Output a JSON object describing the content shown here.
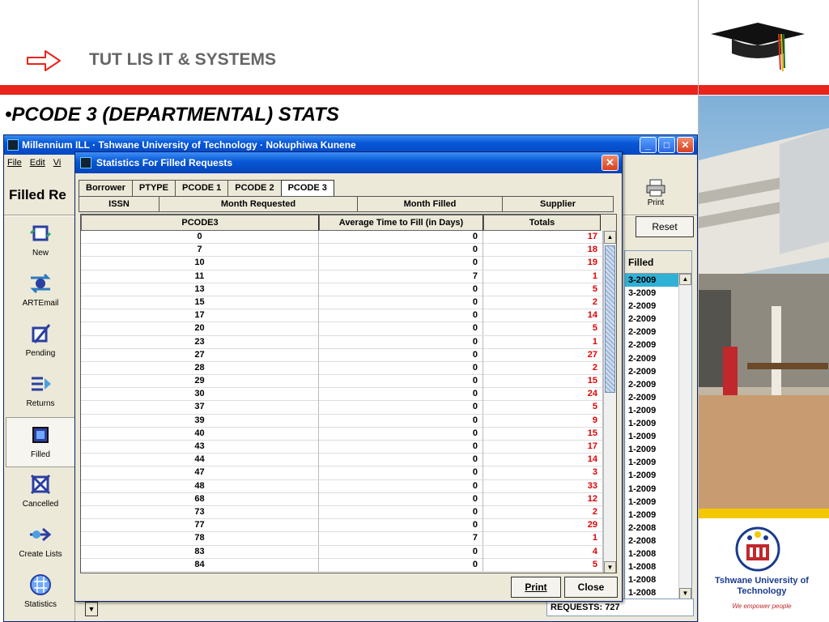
{
  "slide": {
    "title": "TUT LIS IT & SYSTEMS",
    "bullet": "•PCODE 3 (DEPARTMENTAL) STATS",
    "logo_name": "Tshwane University of Technology",
    "logo_motto": "We empower people",
    "colors": {
      "red_bar": "#e8241c",
      "gold_bar": "#f3c800",
      "accent_blue": "#1b3b8c"
    }
  },
  "app": {
    "title": "Millennium ILL · Tshwane University of Technology · Nokuphiwa Kunene",
    "menu": [
      "File",
      "Edit",
      "Vi"
    ],
    "heading": "Filled Re",
    "print_label": "Print",
    "reset_label": "Reset",
    "sidebar": [
      {
        "label": "New",
        "icon": "new-request-icon"
      },
      {
        "label": "ARTEmail",
        "icon": "artemail-icon"
      },
      {
        "label": "Pending",
        "icon": "pending-icon"
      },
      {
        "label": "Returns",
        "icon": "returns-icon"
      },
      {
        "label": "Filled",
        "icon": "filled-icon",
        "active": true
      },
      {
        "label": "Cancelled",
        "icon": "cancelled-icon"
      },
      {
        "label": "Create Lists",
        "icon": "create-lists-icon"
      },
      {
        "label": "Statistics",
        "icon": "statistics-icon"
      }
    ],
    "list_header": "Filled",
    "list_rows": [
      "3-2009",
      "3-2009",
      "2-2009",
      "2-2009",
      "2-2009",
      "2-2009",
      "2-2009",
      "2-2009",
      "2-2009",
      "2-2009",
      "1-2009",
      "1-2009",
      "1-2009",
      "1-2009",
      "1-2009",
      "1-2009",
      "1-2009",
      "1-2009",
      "1-2009",
      "2-2008",
      "2-2008",
      "1-2008",
      "1-2008",
      "1-2008",
      "1-2008"
    ],
    "status": "REQUESTS: 727"
  },
  "dialog": {
    "title": "Statistics For Filled Requests",
    "tabs_row1": [
      "Borrower",
      "PTYPE",
      "PCODE 1",
      "PCODE 2",
      "PCODE 3"
    ],
    "active_tab": "PCODE 3",
    "tabs_row2": [
      "ISSN",
      "Month Requested",
      "Month Filled",
      "Supplier"
    ],
    "columns": [
      "PCODE3",
      "Average Time to Fill (in Days)",
      "Totals"
    ],
    "rows": [
      [
        "0",
        "0",
        "17"
      ],
      [
        "7",
        "0",
        "18"
      ],
      [
        "10",
        "0",
        "19"
      ],
      [
        "11",
        "7",
        "1"
      ],
      [
        "13",
        "0",
        "5"
      ],
      [
        "15",
        "0",
        "2"
      ],
      [
        "17",
        "0",
        "14"
      ],
      [
        "20",
        "0",
        "5"
      ],
      [
        "23",
        "0",
        "1"
      ],
      [
        "27",
        "0",
        "27"
      ],
      [
        "28",
        "0",
        "2"
      ],
      [
        "29",
        "0",
        "15"
      ],
      [
        "30",
        "0",
        "24"
      ],
      [
        "37",
        "0",
        "5"
      ],
      [
        "39",
        "0",
        "9"
      ],
      [
        "40",
        "0",
        "15"
      ],
      [
        "43",
        "0",
        "17"
      ],
      [
        "44",
        "0",
        "14"
      ],
      [
        "47",
        "0",
        "3"
      ],
      [
        "48",
        "0",
        "33"
      ],
      [
        "68",
        "0",
        "12"
      ],
      [
        "73",
        "0",
        "2"
      ],
      [
        "77",
        "0",
        "29"
      ],
      [
        "78",
        "7",
        "1"
      ],
      [
        "83",
        "0",
        "4"
      ],
      [
        "84",
        "0",
        "5"
      ]
    ],
    "print_label": "Print",
    "close_label": "Close"
  }
}
